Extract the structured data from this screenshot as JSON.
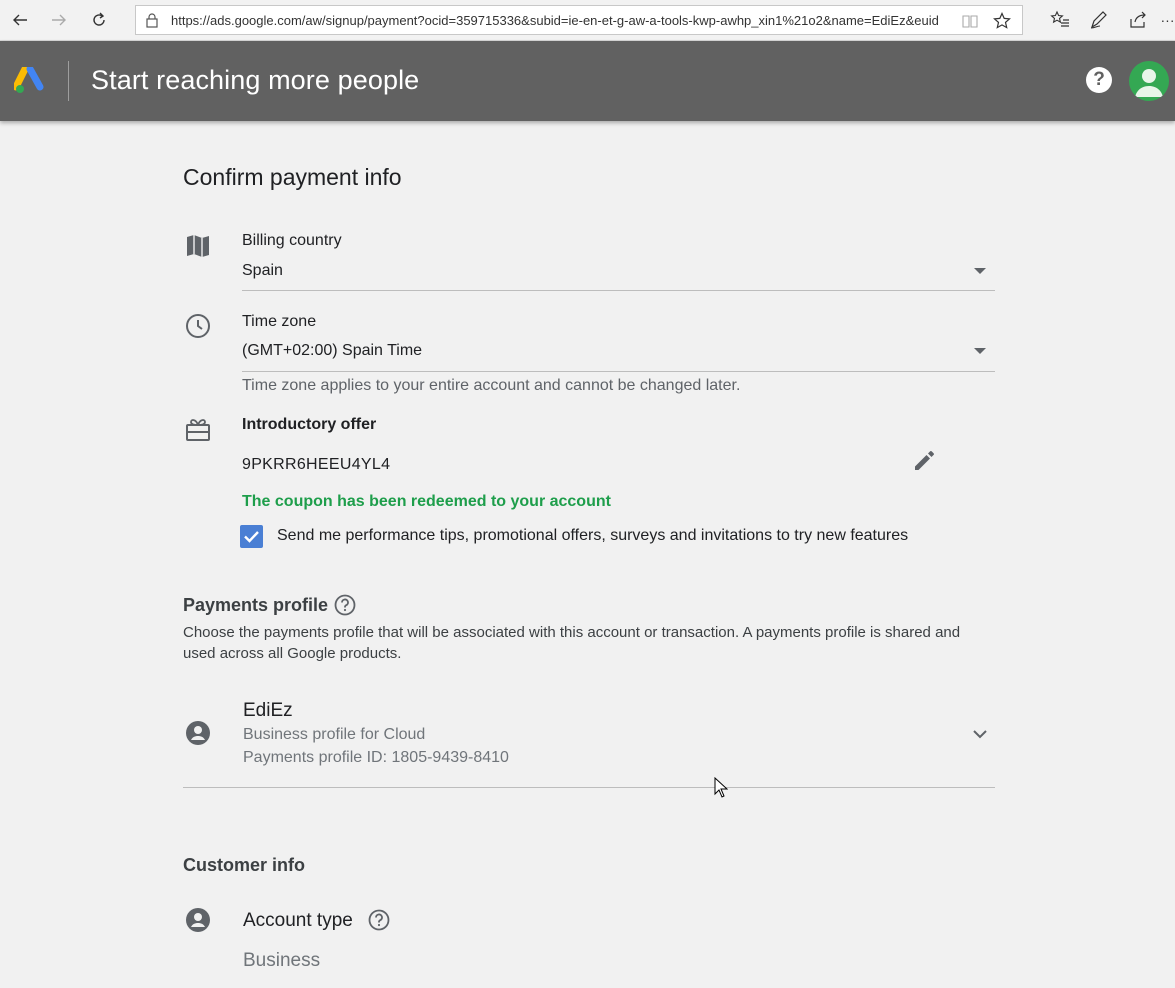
{
  "browser": {
    "url": "https://ads.google.com/aw/signup/payment?ocid=359715336&subid=ie-en-et-g-aw-a-tools-kwp-awhp_xin1%21o2&name=EdiEz&euid",
    "icons": [
      "back-icon",
      "forward-icon",
      "refresh-icon",
      "lock-icon",
      "reading-view-icon",
      "favorite-star-icon",
      "favorites-list-icon",
      "pen-icon",
      "share-icon",
      "more-icon"
    ]
  },
  "header": {
    "title": "Start reaching more people",
    "help_label": "?",
    "background": "#616161"
  },
  "page": {
    "title": "Confirm payment info"
  },
  "billing_country": {
    "label": "Billing country",
    "value": "Spain"
  },
  "time_zone": {
    "label": "Time zone",
    "value": "(GMT+02:00) Spain Time",
    "hint": "Time zone applies to your entire account and cannot be changed later."
  },
  "intro_offer": {
    "label": "Introductory offer",
    "code": "9PKRR6HEEU4YL4",
    "status": "The coupon has been redeemed to your account",
    "status_color": "#1e9e4b"
  },
  "marketing_opt_in": {
    "checked": true,
    "label": "Send me performance tips, promotional offers, surveys and invitations to try new features"
  },
  "payments_profile": {
    "heading": "Payments profile",
    "description": "Choose the payments profile that will be associated with this account or transaction. A payments profile is shared and used across all Google products.",
    "name": "EdiEz",
    "type": "Business profile for Cloud",
    "id_text": "Payments profile ID: 1805-9439-8410"
  },
  "customer_info": {
    "heading": "Customer info",
    "account_type_label": "Account type",
    "account_type_value": "Business"
  }
}
